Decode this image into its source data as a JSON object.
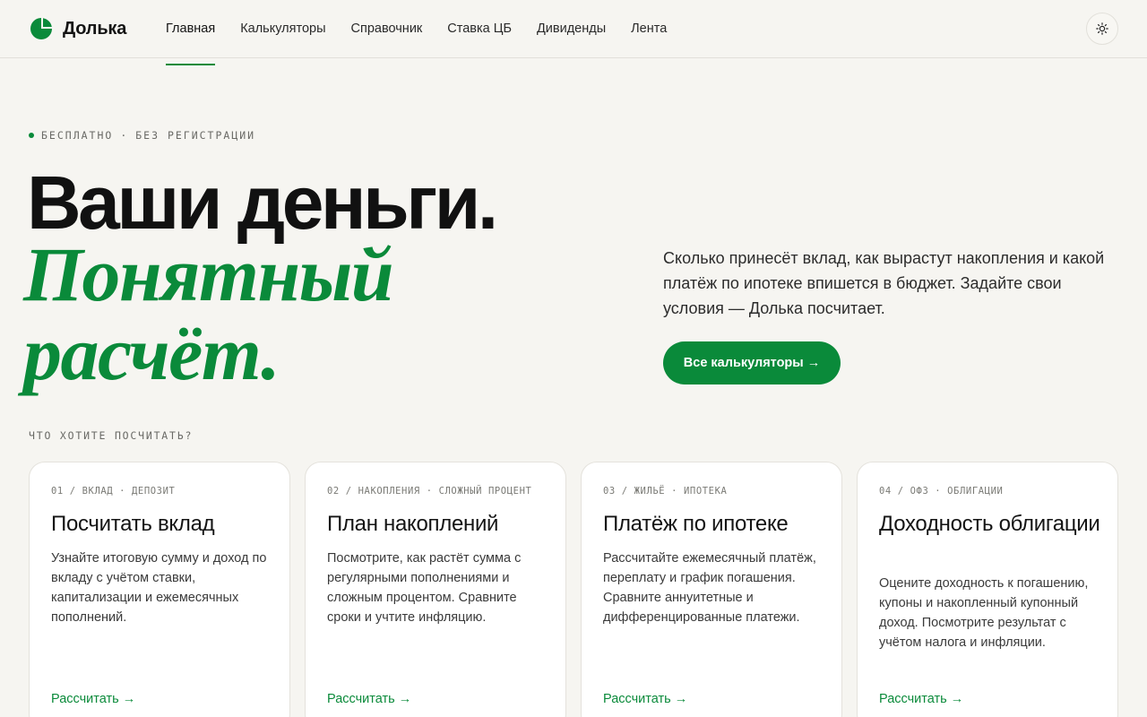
{
  "brand": {
    "name": "Долька"
  },
  "nav": {
    "items": [
      {
        "label": "Главная",
        "active": true
      },
      {
        "label": "Калькуляторы"
      },
      {
        "label": "Справочник"
      },
      {
        "label": "Ставка ЦБ"
      },
      {
        "label": "Дивиденды"
      },
      {
        "label": "Лента"
      }
    ]
  },
  "theme_toggle_icon": "sun-icon",
  "hero": {
    "eyebrow_a": "БЕСПЛАТНО",
    "eyebrow_sep": "·",
    "eyebrow_b": "БЕЗ РЕГИСТРАЦИИ",
    "title": "Ваши деньги.",
    "accent_line1": "Понятный",
    "accent_line2": "расчёт.",
    "lead": "Сколько принесёт вклад, как вырастут накопления и какой платёж по ипотеке впишется в бюджет. Задайте свои условия — Долька посчитает.",
    "cta": "Все калькуляторы →"
  },
  "section": {
    "label": "ЧТО ХОТИТЕ ПОСЧИТАТЬ?"
  },
  "cards": [
    {
      "meta": "01 / ВКЛАД · ДЕПОЗИТ",
      "title": "Посчитать вклад",
      "desc": "Узнайте итоговую сумму и доход по вкладу с учётом ставки, капитализации и ежемесячных пополнений.",
      "link": "Рассчитать →"
    },
    {
      "meta": "02 / НАКОПЛЕНИЯ · СЛОЖНЫЙ ПРОЦЕНТ",
      "title": "План накоплений",
      "desc": "Посмотрите, как растёт сумма с регулярными пополнениями и сложным процентом. Сравните сроки и учтите инфляцию.",
      "link": "Рассчитать →"
    },
    {
      "meta": "03 / ЖИЛЬЁ · ИПОТЕКА",
      "title": "Платёж по ипотеке",
      "desc": "Рассчитайте ежемесячный платёж, переплату и график погашения. Сравните аннуитетные и дифференцированные платежи.",
      "link": "Рассчитать →"
    },
    {
      "meta": "04 / ОФЗ · ОБЛИГАЦИИ",
      "title": "Доходность облигации",
      "desc": "Оцените доходность к погашению, купоны и накопленный купонный доход. Посмотрите результат с учётом налога и инфляции.",
      "link": "Рассчитать →"
    }
  ],
  "colors": {
    "accent": "#0a8a3a",
    "background": "#f6f5f1",
    "text": "#141414"
  }
}
